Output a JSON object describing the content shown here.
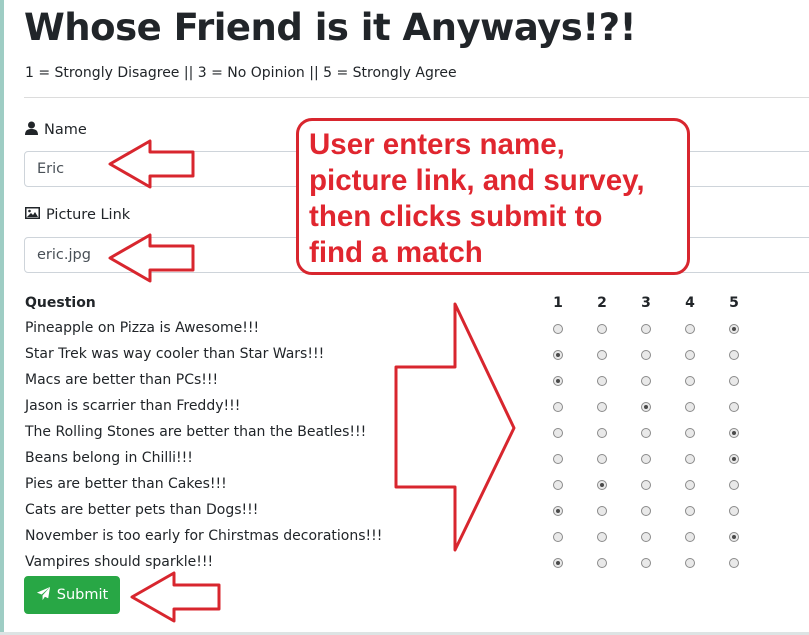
{
  "page": {
    "title": "Whose Friend is it Anyways!?!",
    "scale_legend": "1 = Strongly Disagree || 3 = No Opinion || 5 = Strongly Agree"
  },
  "form": {
    "name_label": "Name",
    "name_value": "Eric",
    "picture_label": "Picture Link",
    "picture_value": "eric.jpg",
    "submit_label": "Submit"
  },
  "survey": {
    "question_header": "Question",
    "scale": [
      "1",
      "2",
      "3",
      "4",
      "5"
    ],
    "questions": [
      {
        "text": "Pineapple on Pizza is Awesome!!!",
        "selected": 5
      },
      {
        "text": "Star Trek was way cooler than Star Wars!!!",
        "selected": 1
      },
      {
        "text": "Macs are better than PCs!!!",
        "selected": 1
      },
      {
        "text": "Jason is scarrier than Freddy!!!",
        "selected": 3
      },
      {
        "text": "The Rolling Stones are better than the Beatles!!!",
        "selected": 5
      },
      {
        "text": "Beans belong in Chilli!!!",
        "selected": 5
      },
      {
        "text": "Pies are better than Cakes!!!",
        "selected": 2
      },
      {
        "text": "Cats are better pets than Dogs!!!",
        "selected": 1
      },
      {
        "text": "November is too early for Chirstmas decorations!!!",
        "selected": 5
      },
      {
        "text": "Vampires should sparkle!!!",
        "selected": 1
      }
    ]
  },
  "annotation": {
    "callout_lines": [
      "User enters name,",
      "picture link, and survey,",
      "then clicks submit to",
      "find a match"
    ],
    "accent_color": "#e0262f"
  },
  "colors": {
    "submit_bg": "#28a745"
  },
  "icons": {
    "name": "user-icon",
    "picture": "image-icon",
    "submit": "paper-plane-icon"
  }
}
